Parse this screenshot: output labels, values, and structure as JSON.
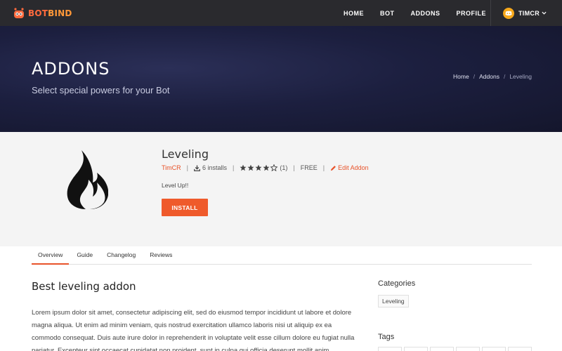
{
  "brand": {
    "part1": "BOT",
    "part2": "BIND"
  },
  "nav": {
    "items": [
      {
        "label": "HOME"
      },
      {
        "label": "BOT"
      },
      {
        "label": "ADDONS"
      },
      {
        "label": "PROFILE"
      }
    ],
    "user": "TIMCR"
  },
  "hero": {
    "title": "ADDONS",
    "subtitle": "Select special powers for your Bot",
    "breadcrumb": [
      "Home",
      "Addons",
      "Leveling"
    ]
  },
  "addon": {
    "name": "Leveling",
    "author": "TimCR",
    "installs": "6 installs",
    "rating": 4,
    "rating_max": 5,
    "rating_count": "(1)",
    "price": "FREE",
    "edit_label": "Edit Addon",
    "tagline": "Level Up!!",
    "install_label": "INSTALL",
    "icon": "flame-icon"
  },
  "tabs": [
    {
      "label": "Overview",
      "active": true
    },
    {
      "label": "Guide",
      "active": false
    },
    {
      "label": "Changelog",
      "active": false
    },
    {
      "label": "Reviews",
      "active": false
    }
  ],
  "content": {
    "title": "Best leveling addon",
    "body": "Lorem ipsum dolor sit amet, consectetur adipiscing elit, sed do eiusmod tempor incididunt ut labore et dolore magna aliqua. Ut enim ad minim veniam, quis nostrud exercitation ullamco laboris nisi ut aliquip ex ea commodo consequat. Duis aute irure dolor in reprehenderit in voluptate velit esse cillum dolore eu fugiat nulla pariatur. Excepteur sint occaecat cupidatat non proident, sunt in culpa qui officia deserunt mollit anim"
  },
  "sidebar": {
    "categories_heading": "Categories",
    "categories": [
      "Leveling"
    ],
    "tags_heading": "Tags"
  },
  "colors": {
    "accent": "#ef5a2b",
    "topbar": "#2a2a2e",
    "hero": "#1c1f3f"
  }
}
